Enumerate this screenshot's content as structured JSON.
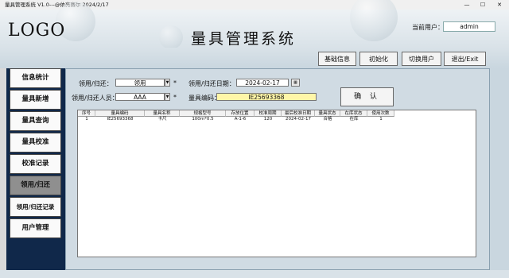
{
  "window": {
    "title": "量具管理系统 V1.0---@依亮赛尔 2024/2/17",
    "minimize": "—",
    "maximize": "☐",
    "close": "✕"
  },
  "header": {
    "logo": "LOGO",
    "app_title": "量具管理系统",
    "current_user_label": "当前用户：",
    "current_user": "admin"
  },
  "toolbar": {
    "basic_info": "基础信息",
    "initialize": "初始化",
    "switch_user": "切换用户",
    "exit": "退出/Exit"
  },
  "sidebar": {
    "items": [
      {
        "label": "信息统计"
      },
      {
        "label": "量具新增"
      },
      {
        "label": "量具查询"
      },
      {
        "label": "量具校准"
      },
      {
        "label": "校准记录"
      },
      {
        "label": "领用/归还"
      },
      {
        "label": "领用/归还记录"
      },
      {
        "label": "用户管理"
      }
    ],
    "active_index": 5
  },
  "form": {
    "borrow_return_label": "领用/归还：",
    "borrow_return_value": "领用",
    "date_label": "领用/归还日期：",
    "date_value": "2024-02-17",
    "person_label": "领用/归还人员：",
    "person_value": "AAA",
    "code_label": "量具编码：",
    "code_value": "IE25693368",
    "required_mark": "*",
    "confirm": "确 认"
  },
  "table": {
    "headers": [
      "序号",
      "量具编码",
      "量具名称",
      "规格型号",
      "存放位置",
      "校准周期",
      "最后校准日期",
      "量具状态",
      "在库状态",
      "使用次数"
    ],
    "rows": [
      [
        "1",
        "IE25693368",
        "卡尺",
        "100m*0.5",
        "A-1-6",
        "120",
        "2024-02-17",
        "合格",
        "在库",
        "1"
      ]
    ]
  },
  "colors": {
    "sidebar_bg": "#10284a",
    "active_nav": "#8f8f8f",
    "code_field_bg": "#fff6a8"
  }
}
